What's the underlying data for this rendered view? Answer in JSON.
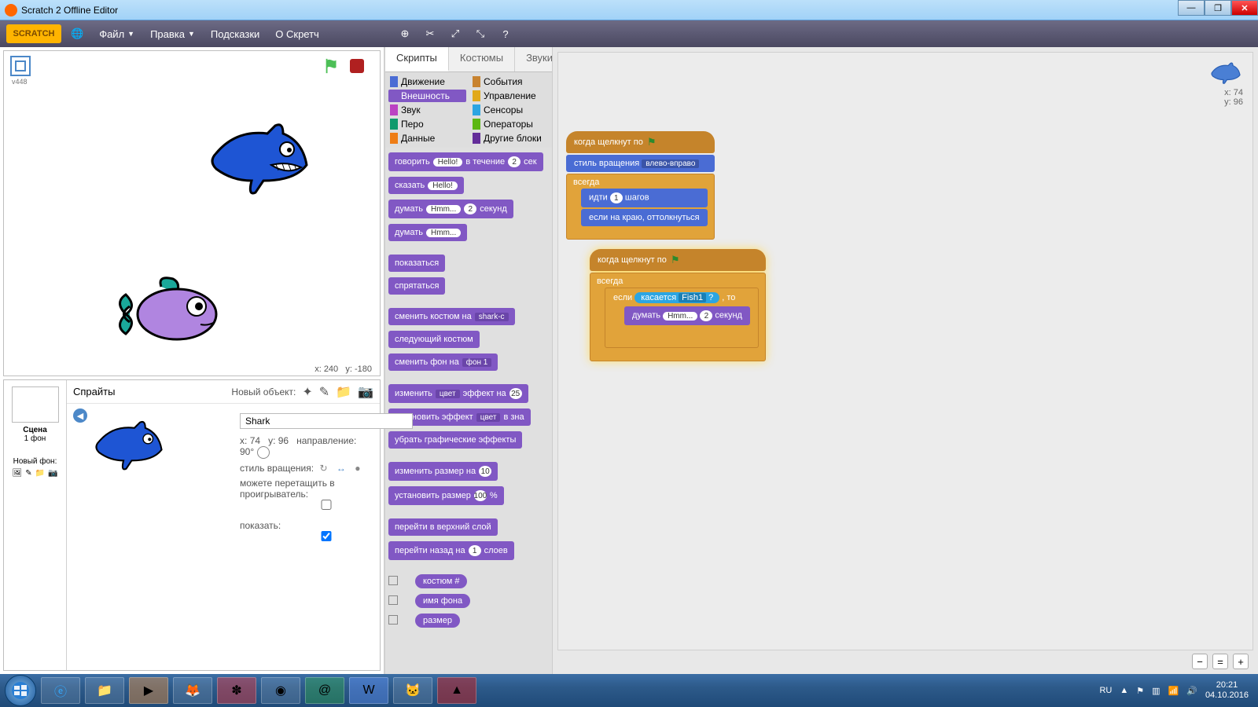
{
  "window": {
    "title": "Scratch 2 Offline Editor"
  },
  "menu": {
    "file": "Файл",
    "edit": "Правка",
    "tips": "Подсказки",
    "about": "О Скретч"
  },
  "version": "v448",
  "stage": {
    "coord_label_x": "x:",
    "coord_label_y": "y:",
    "mx": "240",
    "my": "-180"
  },
  "sprite_panel": {
    "header": "Спрайты",
    "new_label": "Новый объект:",
    "stage_label": "Сцена",
    "stage_sub": "1 фон",
    "new_bg": "Новый фон:"
  },
  "sprite_info": {
    "name": "Shark",
    "x_lbl": "x:",
    "x": "74",
    "y_lbl": "y:",
    "y": "96",
    "dir_lbl": "направление:",
    "dir": "90°",
    "rot_lbl": "стиль вращения:",
    "drag_lbl": "можете перетащить в проигрыватель:",
    "show_lbl": "показать:"
  },
  "tabs": {
    "scripts": "Скрипты",
    "costumes": "Костюмы",
    "sounds": "Звуки"
  },
  "categories": {
    "motion": "Движение",
    "looks": "Внешность",
    "sound": "Звук",
    "pen": "Перо",
    "data": "Данные",
    "events": "События",
    "control": "Управление",
    "sensing": "Сенсоры",
    "operators": "Операторы",
    "more": "Другие блоки"
  },
  "cat_colors": {
    "motion": "#4a6cd4",
    "looks": "#8158c4",
    "sound": "#bb42c3",
    "pen": "#0e9a6c",
    "data": "#ee7d16",
    "events": "#c88330",
    "control": "#e1a91a",
    "sensing": "#2ca5e2",
    "operators": "#5cb712",
    "more": "#632d99"
  },
  "palette": {
    "say_for": [
      "говорить",
      "Hello!",
      "в течение",
      "2",
      "сек"
    ],
    "say": [
      "сказать",
      "Hello!"
    ],
    "think_for": [
      "думать",
      "Hmm...",
      "2",
      "секунд"
    ],
    "think": [
      "думать",
      "Hmm..."
    ],
    "show": "показаться",
    "hide": "спрятаться",
    "switch_cost": [
      "сменить костюм на",
      "shark-c"
    ],
    "next_cost": "следующий костюм",
    "switch_bg": [
      "сменить фон на",
      "фон 1"
    ],
    "change_effect": [
      "изменить",
      "цвет",
      "эффект на",
      "25"
    ],
    "set_effect": [
      "установить эффект",
      "цвет",
      "в зна"
    ],
    "clear_effects": "убрать графические эффекты",
    "change_size": [
      "изменить размер на",
      "10"
    ],
    "set_size": [
      "установить размер",
      "100",
      "%"
    ],
    "go_front": "перейти в верхний слой",
    "go_back": [
      "перейти назад на",
      "1",
      "слоев"
    ],
    "costume_num": "костюм #",
    "bg_name": "имя фона",
    "size_rep": "размер"
  },
  "script1": {
    "hat": "когда щелкнут по",
    "rot_style": [
      "стиль вращения",
      "влево-вправо"
    ],
    "forever": "всегда",
    "move": [
      "идти",
      "1",
      "шагов"
    ],
    "bounce": "если на краю, оттолкнуться"
  },
  "script2": {
    "hat": "когда щелкнут по",
    "forever": "всегда",
    "if": "если",
    "then": ", то",
    "touching": [
      "касается",
      "Fish1",
      "?"
    ],
    "think": [
      "думать",
      "Hmm...",
      "2",
      "секунд"
    ]
  },
  "preview": {
    "x_lbl": "x:",
    "x": "74",
    "y_lbl": "y:",
    "y": "96"
  },
  "tray": {
    "lang": "RU",
    "time": "20:21",
    "date": "04.10.2016"
  }
}
